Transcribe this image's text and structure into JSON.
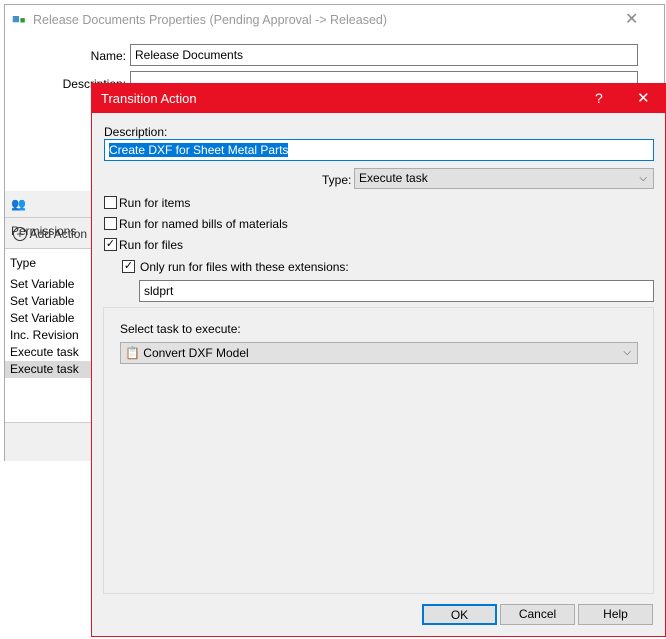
{
  "back_window": {
    "title": "Release Documents Properties (Pending Approval -> Released)",
    "name_label": "Name:",
    "name_value": "Release Documents",
    "description_label": "Description:",
    "permissions_tab": "Permissions",
    "add_action": "Add Action",
    "list_header": "Type",
    "list_items": [
      "Set Variable",
      "Set Variable",
      "Set Variable",
      "Inc. Revision",
      "Execute task",
      "Execute task"
    ],
    "selected_index": 5
  },
  "dialog": {
    "title": "Transition Action",
    "help": "?",
    "close": "✕",
    "description_label": "Description:",
    "description_value": "Create DXF for Sheet Metal Parts",
    "type_label": "Type:",
    "type_value": "Execute task",
    "checks": [
      {
        "label": "Run for items",
        "checked": false
      },
      {
        "label": "Run for named bills of materials",
        "checked": false
      },
      {
        "label": "Run for files",
        "checked": true
      }
    ],
    "ext_check": {
      "label": "Only run for files with these extensions:",
      "checked": true
    },
    "ext_value": "sldprt",
    "task_label": "Select task to execute:",
    "task_value": "Convert DXF Model",
    "ok": "OK",
    "cancel": "Cancel",
    "help_btn": "Help",
    "accent": "#e81123"
  }
}
